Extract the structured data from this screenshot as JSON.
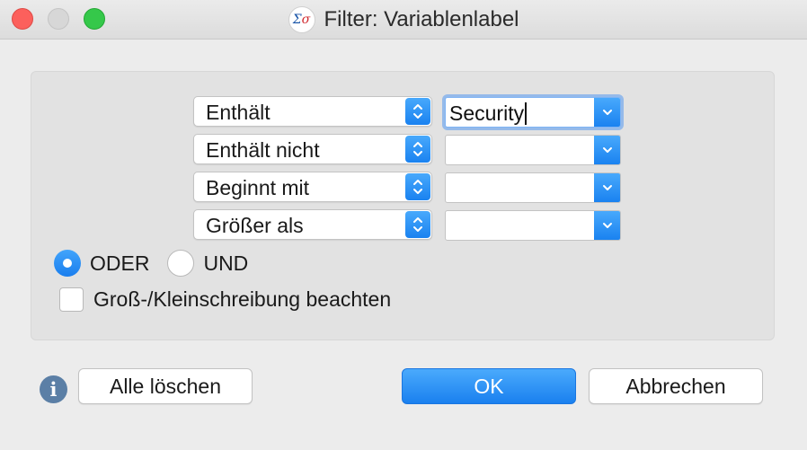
{
  "window": {
    "title": "Filter: Variablenlabel",
    "app_icon_glyph_1": "Σ",
    "app_icon_glyph_2": "σ"
  },
  "filters": [
    {
      "operator": "Enthält",
      "value": "Security"
    },
    {
      "operator": "Enthält nicht",
      "value": ""
    },
    {
      "operator": "Beginnt mit",
      "value": ""
    },
    {
      "operator": "Größer als",
      "value": ""
    }
  ],
  "logic": {
    "or_label": "ODER",
    "and_label": "UND",
    "selected": "ODER"
  },
  "case_sensitive": {
    "label": "Groß-/Kleinschreibung beachten",
    "checked": false
  },
  "buttons": {
    "clear_all": "Alle löschen",
    "ok": "OK",
    "cancel": "Abbrechen"
  },
  "icons": {
    "info": "info-icon",
    "info_glyph": "i"
  },
  "colors": {
    "accent": "#1a82f0",
    "close": "#fc605c",
    "zoom": "#35c84a",
    "info": "#5b7fa6"
  }
}
